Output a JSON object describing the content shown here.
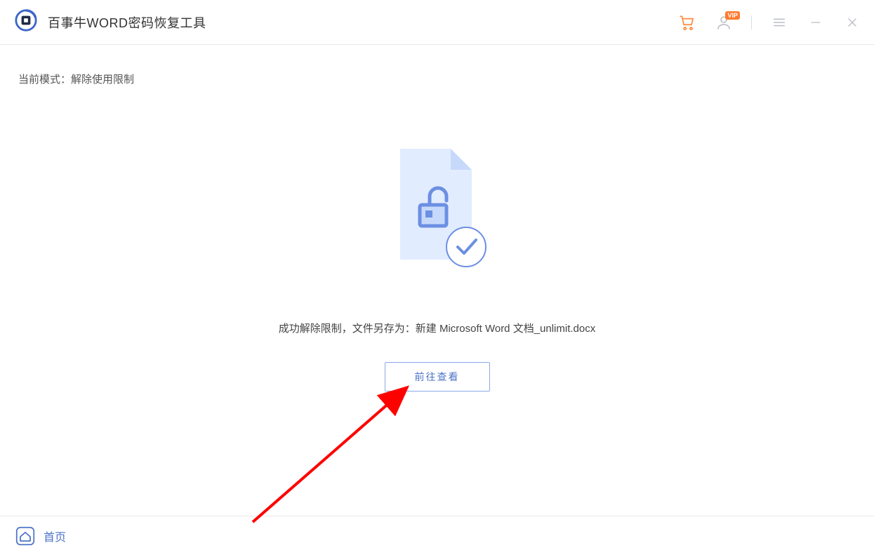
{
  "header": {
    "app_title": "百事牛WORD密码恢复工具",
    "vip_badge": "VIP"
  },
  "main": {
    "mode_label": "当前模式：",
    "mode_value": "解除使用限制",
    "success_prefix": "成功解除限制，文件另存为：",
    "saved_filename": "新建 Microsoft Word 文档_unlimit.docx",
    "view_button_label": "前往查看"
  },
  "footer": {
    "home_label": "首页"
  }
}
